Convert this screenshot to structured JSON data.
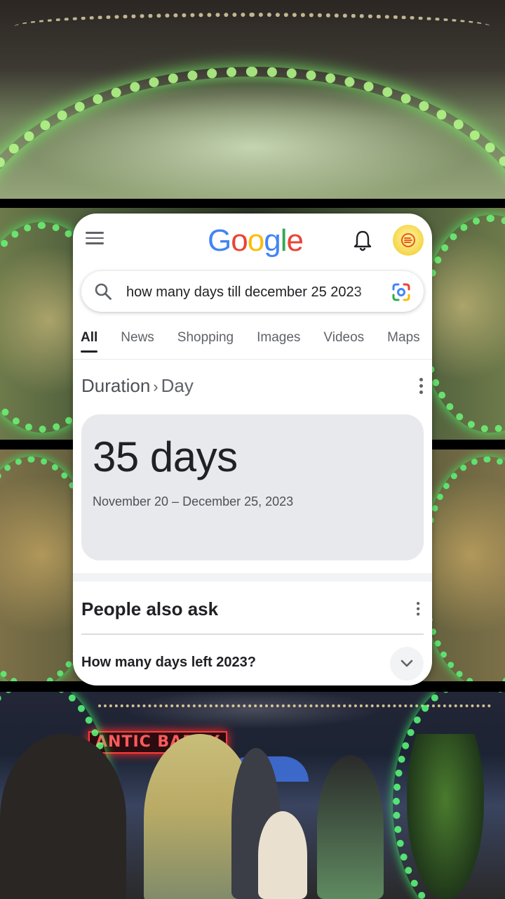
{
  "background": {
    "stall_sign": "ANTIC BABOY"
  },
  "app": {
    "logo": "Google",
    "menu_icon": "hamburger-menu-icon",
    "notification_icon": "bell-icon",
    "avatar_icon": "profile-avatar"
  },
  "search": {
    "query": "how many days till december 25 2023",
    "search_icon": "search-icon",
    "lens_icon": "google-lens-icon"
  },
  "tabs": [
    {
      "label": "All",
      "active": true
    },
    {
      "label": "News",
      "active": false
    },
    {
      "label": "Shopping",
      "active": false
    },
    {
      "label": "Images",
      "active": false
    },
    {
      "label": "Videos",
      "active": false
    },
    {
      "label": "Maps",
      "active": false
    }
  ],
  "result": {
    "breadcrumb_category": "Duration",
    "breadcrumb_separator": "›",
    "breadcrumb_unit": "Day",
    "value": "35 days",
    "date_range": "November 20 – December 25, 2023"
  },
  "people_also_ask": {
    "title": "People also ask",
    "questions": [
      "How many days left 2023?"
    ]
  },
  "colors": {
    "google_blue": "#4285F4",
    "google_red": "#EA4335",
    "google_yellow": "#FBBC05",
    "google_green": "#34A853",
    "text_primary": "#202124",
    "text_secondary": "#5f6368",
    "result_card_bg": "#e8e9ec"
  }
}
